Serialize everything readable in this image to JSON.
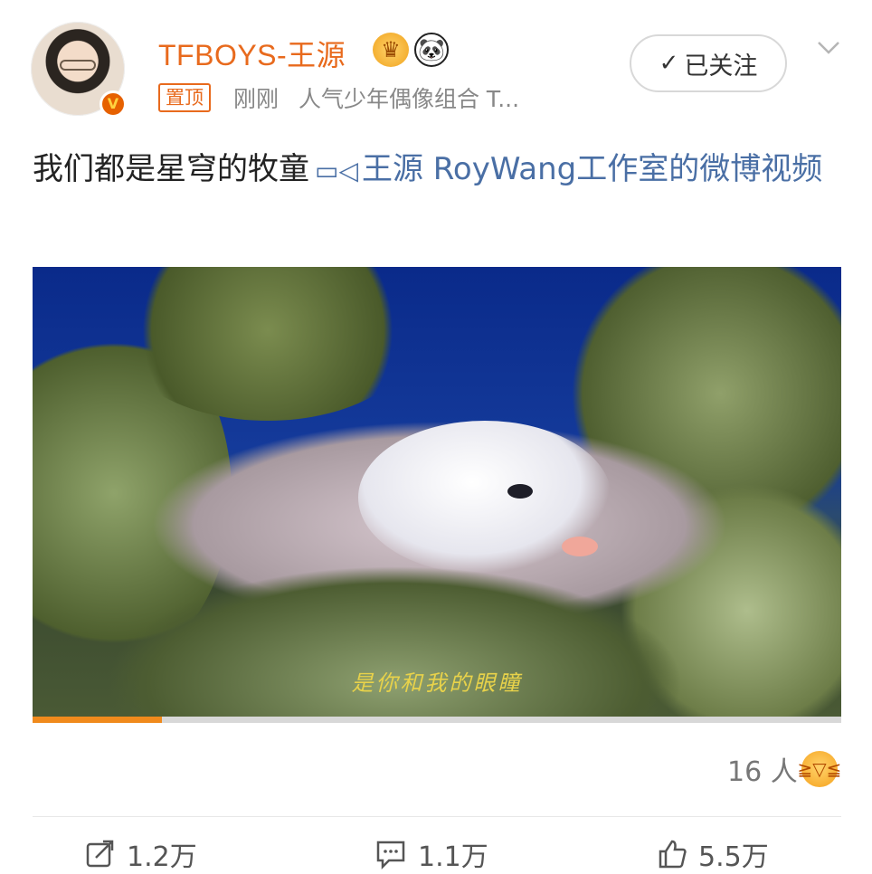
{
  "user": {
    "name": "TFBOYS-王源",
    "pinned_label": "置顶",
    "time": "刚刚",
    "description": "人气少年偶像组合 T..."
  },
  "follow_button": {
    "label": "已关注"
  },
  "post": {
    "text": "我们都是星穹的牧童",
    "video_link": "王源 RoyWang工作室的微博视频"
  },
  "video": {
    "subtitle": "是你和我的眼瞳",
    "progress": 0.16
  },
  "reactions": {
    "count": "16 人"
  },
  "actions": {
    "repost": "1.2万",
    "comment": "1.1万",
    "like": "5.5万"
  },
  "colors": {
    "accent": "#e86a1d",
    "link": "#4a6fa5",
    "progress": "#f08a1c"
  },
  "icons": [
    "verified-v-icon",
    "crown-icon",
    "panda-icon",
    "check-icon",
    "chevron-down-icon",
    "video-camera-icon",
    "laugh-emoji-icon",
    "repost-icon",
    "comment-icon",
    "like-icon"
  ]
}
